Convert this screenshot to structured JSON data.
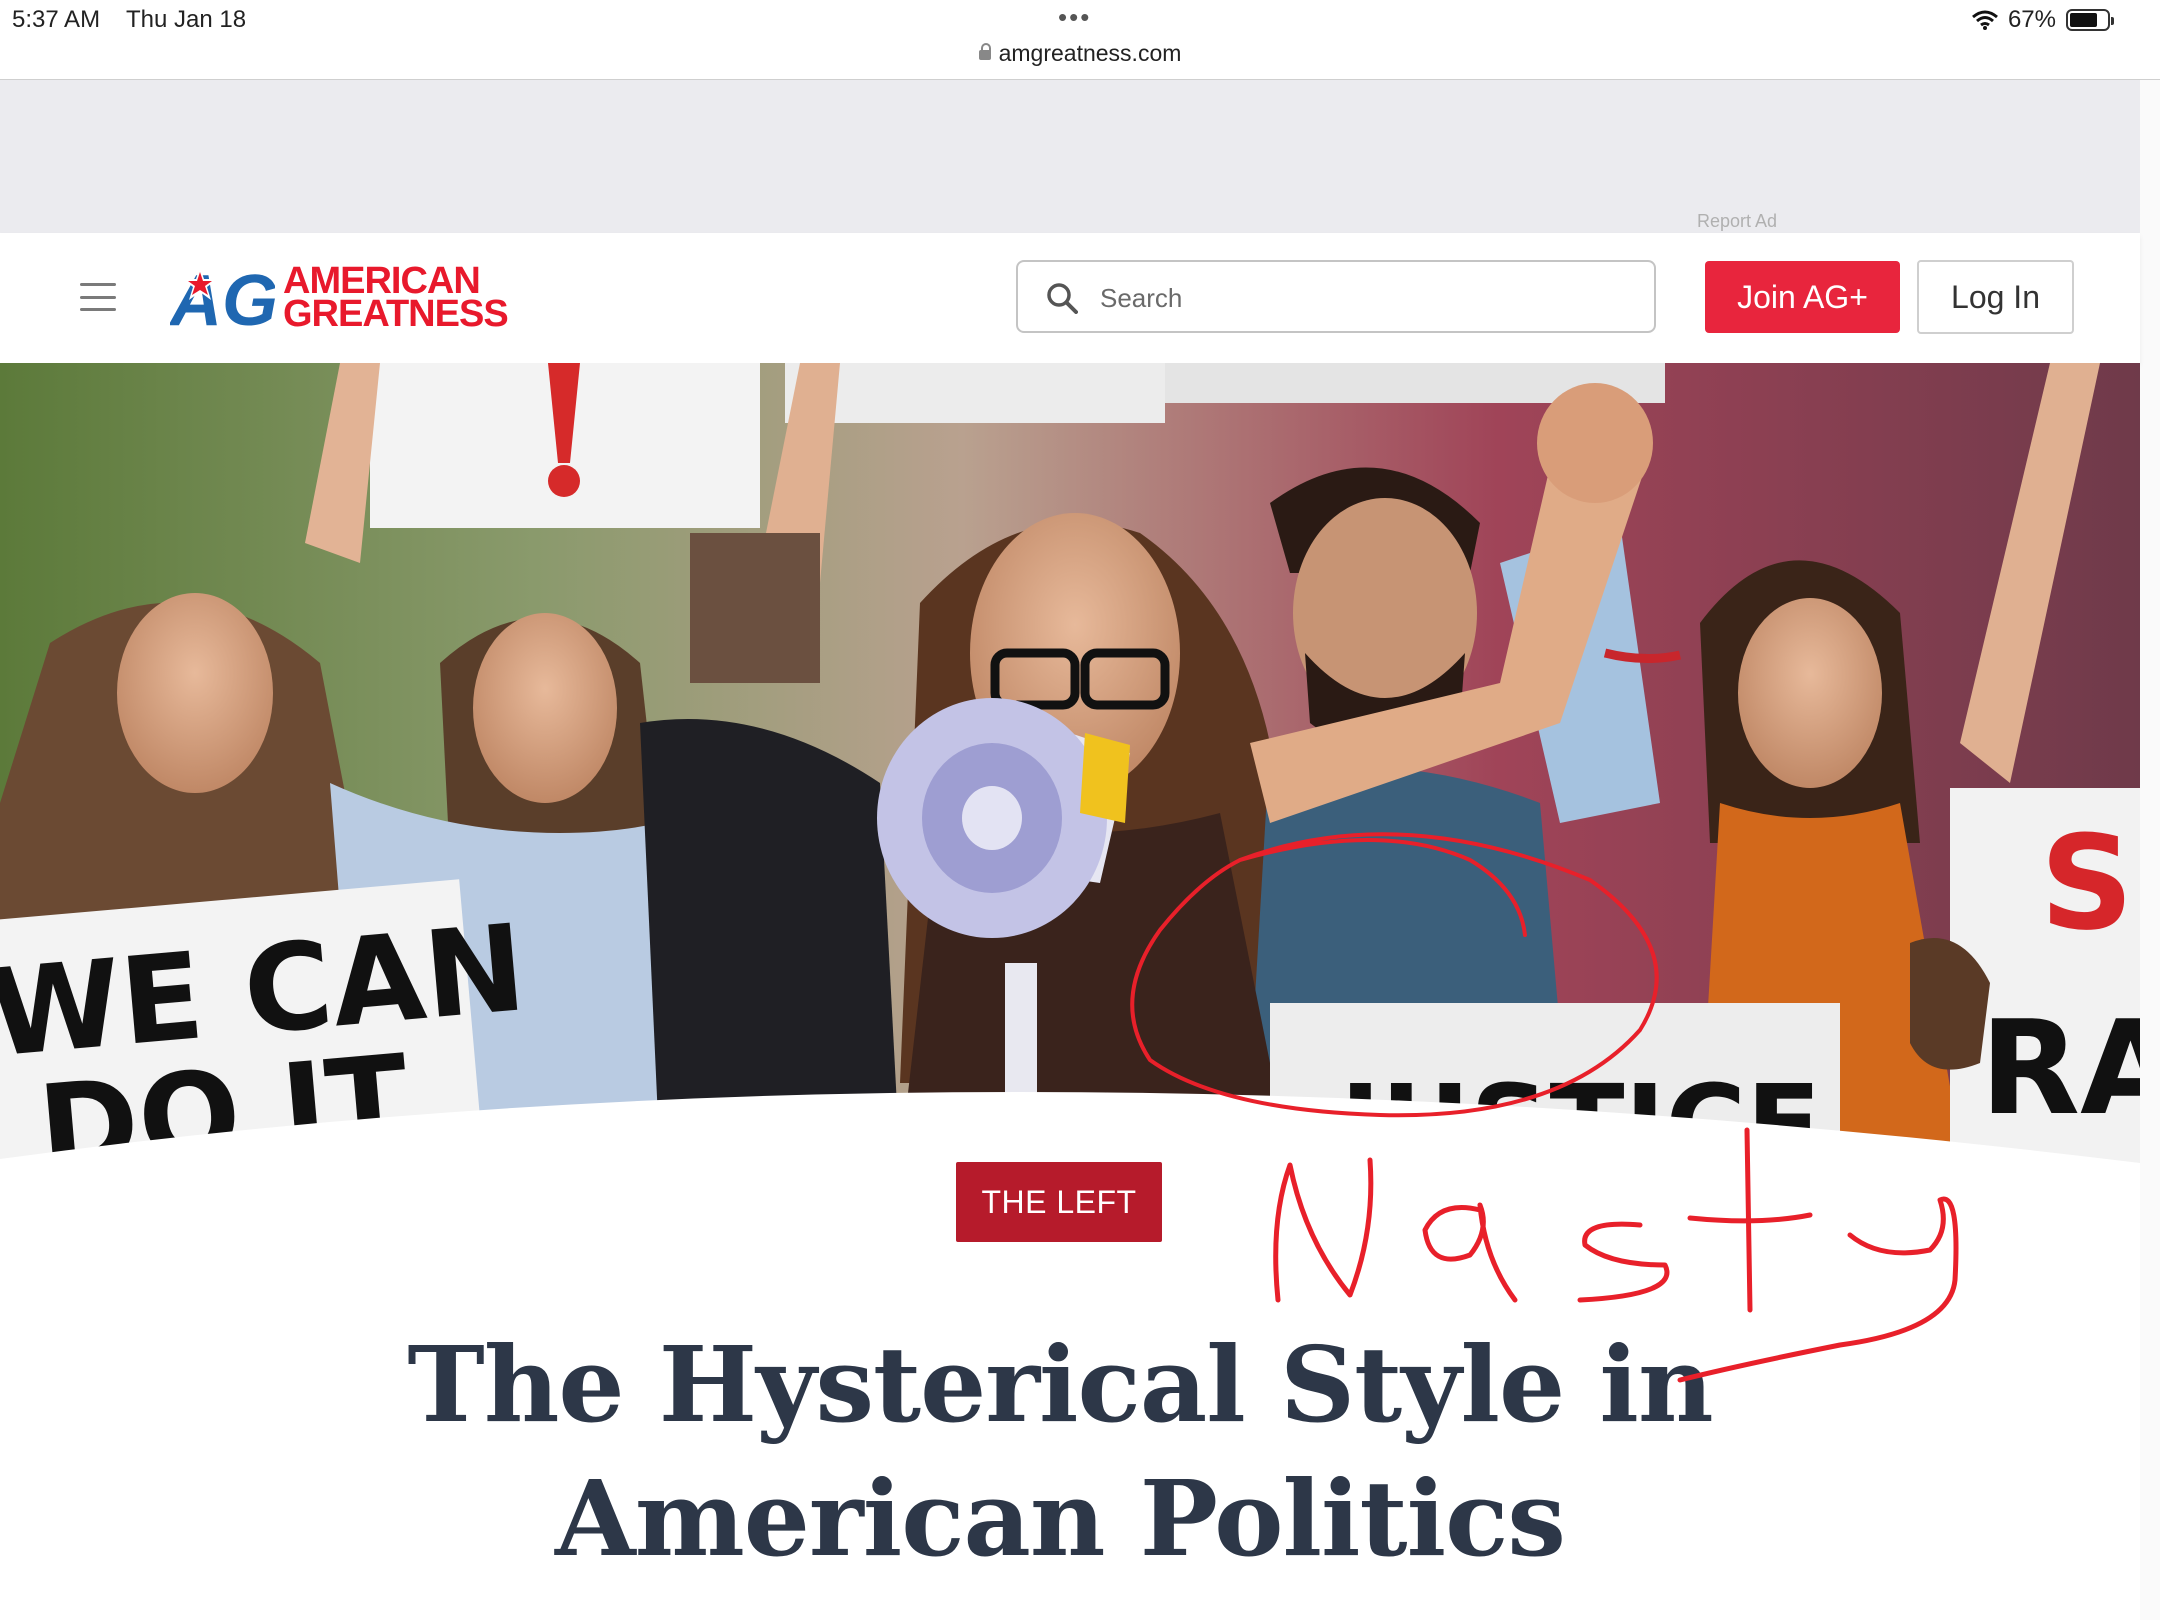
{
  "status_bar": {
    "time": "5:37 AM",
    "date": "Thu Jan 18",
    "url": "amgreatness.com",
    "battery": "67%",
    "battery_level": 0.67
  },
  "ad": {
    "report_label": "Report Ad"
  },
  "header": {
    "logo_line1": "AMERICAN",
    "logo_line2": "GREATNESS",
    "search_placeholder": "Search",
    "join_label": "Join AG+",
    "login_label": "Log In"
  },
  "hero": {
    "sign_left": "WE CAN",
    "sign_left_partial": "DO IT",
    "sign_right_top": "S",
    "sign_right_bottom": "RA",
    "sign_center": "JUSTICE"
  },
  "article": {
    "category": "THE LEFT",
    "title_line1": "The Hysterical Style in",
    "title_line2": "American Politics"
  },
  "annotation": {
    "text": "Nasty",
    "color": "#e8202a"
  },
  "colors": {
    "brand_red": "#e8192c",
    "brand_blue": "#1f67b1",
    "category_red": "#b61b2b",
    "title": "#2d3748"
  }
}
